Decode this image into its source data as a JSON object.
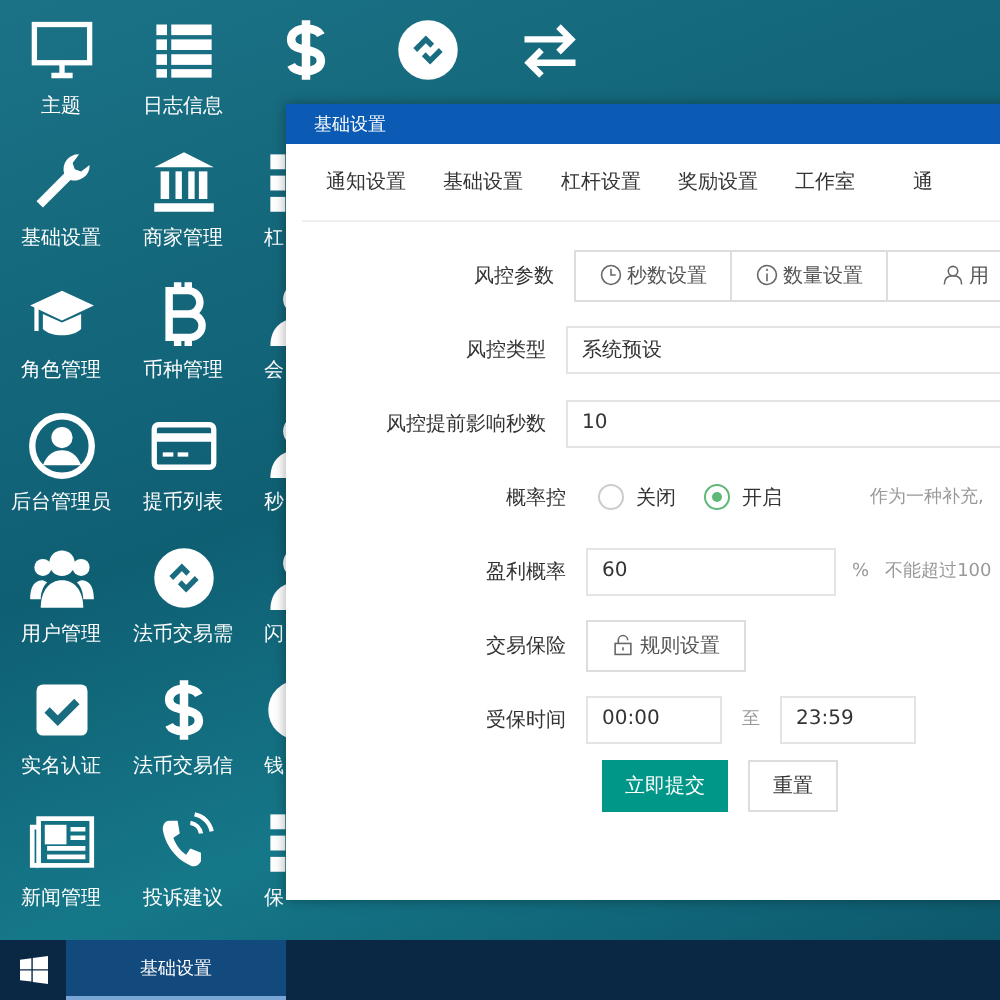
{
  "desktop": {
    "rows": [
      [
        {
          "kind": "monitor",
          "label": "主题"
        },
        {
          "kind": "list",
          "label": "日志信息"
        },
        {
          "kind": "dollar"
        },
        {
          "kind": "link-circle"
        },
        {
          "kind": "arrows"
        }
      ],
      [
        {
          "kind": "wrench",
          "label": "基础设置"
        },
        {
          "kind": "bank",
          "label": "商家管理"
        },
        {
          "kind": "grid",
          "label": "杠"
        }
      ],
      [
        {
          "kind": "cap",
          "label": "角色管理"
        },
        {
          "kind": "bitcoin",
          "label": "币种管理"
        },
        {
          "kind": "user",
          "label": "会"
        }
      ],
      [
        {
          "kind": "user-circle",
          "label": "后台管理员"
        },
        {
          "kind": "card",
          "label": "提币列表"
        },
        {
          "kind": "user",
          "label": "秒"
        }
      ],
      [
        {
          "kind": "users",
          "label": "用户管理"
        },
        {
          "kind": "link-circle",
          "label": "法币交易需"
        },
        {
          "kind": "user",
          "label": "闪"
        }
      ],
      [
        {
          "kind": "check",
          "label": "实名认证"
        },
        {
          "kind": "dollar",
          "label": "法币交易信"
        },
        {
          "kind": "circle",
          "label": "钱"
        }
      ],
      [
        {
          "kind": "news",
          "label": "新闻管理"
        },
        {
          "kind": "phone",
          "label": "投诉建议"
        },
        {
          "kind": "grid",
          "label": "保"
        }
      ]
    ]
  },
  "window": {
    "title": "基础设置",
    "tabs": [
      "通知设置",
      "基础设置",
      "杠杆设置",
      "奖励设置",
      "工作室",
      "通"
    ],
    "form": [
      {
        "kind": "button-group",
        "label": "风控参数",
        "buttons": [
          "秒数设置",
          "数量设置",
          "用"
        ]
      },
      {
        "kind": "select",
        "label": "风控类型",
        "value": "系统预设"
      },
      {
        "kind": "input",
        "label": "风控提前影响秒数",
        "value": "10"
      },
      {
        "kind": "radio",
        "label": "概率控",
        "options": [
          {
            "text": "关闭",
            "selected": false
          },
          {
            "text": "开启",
            "selected": true
          }
        ],
        "hint": "作为一种补充,"
      },
      {
        "kind": "input-suffix",
        "label": "盈利概率",
        "value": "60",
        "suffix": "%",
        "hint": "不能超过100"
      },
      {
        "kind": "button",
        "label": "交易保险",
        "text": "规则设置"
      },
      {
        "kind": "time-range",
        "label": "受保时间",
        "from": "00:00",
        "sep": "至",
        "to": "23:59"
      }
    ],
    "actions": {
      "submit": "立即提交",
      "reset": "重置"
    }
  },
  "taskbar": {
    "task": "基础设置"
  }
}
